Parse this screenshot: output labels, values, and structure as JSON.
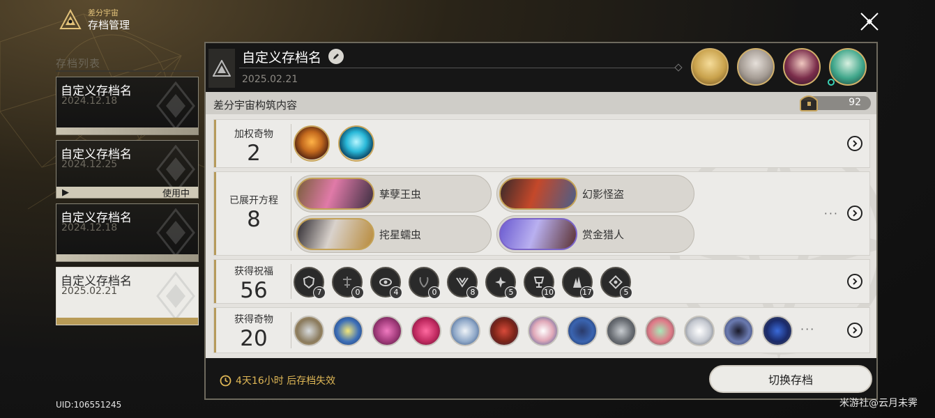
{
  "app": {
    "subtitle": "差分宇宙",
    "title": "存档管理"
  },
  "save_list": {
    "title": "存档列表",
    "cards": [
      {
        "name": "自定义存档名",
        "date": "2024.12.18"
      },
      {
        "name": "自定义存档名",
        "date": "2024.12.25",
        "status": "使用中"
      },
      {
        "name": "自定义存档名",
        "date": "2024.12.18"
      },
      {
        "name": "自定义存档名",
        "date": "2025.02.21"
      }
    ]
  },
  "uid": "UID:106551245",
  "main": {
    "save_title": "自定义存档名",
    "save_date": "2025.02.21",
    "content_title": "差分宇宙构筑内容",
    "count": "92"
  },
  "rows": {
    "weighted_curios": {
      "label": "加权奇物",
      "value": "2"
    },
    "equations": {
      "label": "已展开方程",
      "value": "8",
      "items": [
        {
          "name": "孳孽王虫"
        },
        {
          "name": "幻影怪盗"
        },
        {
          "name": "挓星蠕虫"
        },
        {
          "name": "赏金猎人"
        }
      ],
      "more": "···"
    },
    "blessings": {
      "label": "获得祝福",
      "value": "56",
      "counts": [
        "7",
        "0",
        "4",
        "0",
        "8",
        "5",
        "10",
        "17",
        "5"
      ]
    },
    "curios": {
      "label": "获得奇物",
      "value": "20",
      "more": "···"
    }
  },
  "footer": {
    "timer": "4天16小时 后存档失效",
    "switch_label": "切换存档"
  },
  "watermark": "米游社@云月未霁",
  "colors": {
    "gold": "#c9a65e",
    "timer": "#e0b856",
    "panel": "#e4e2de"
  }
}
